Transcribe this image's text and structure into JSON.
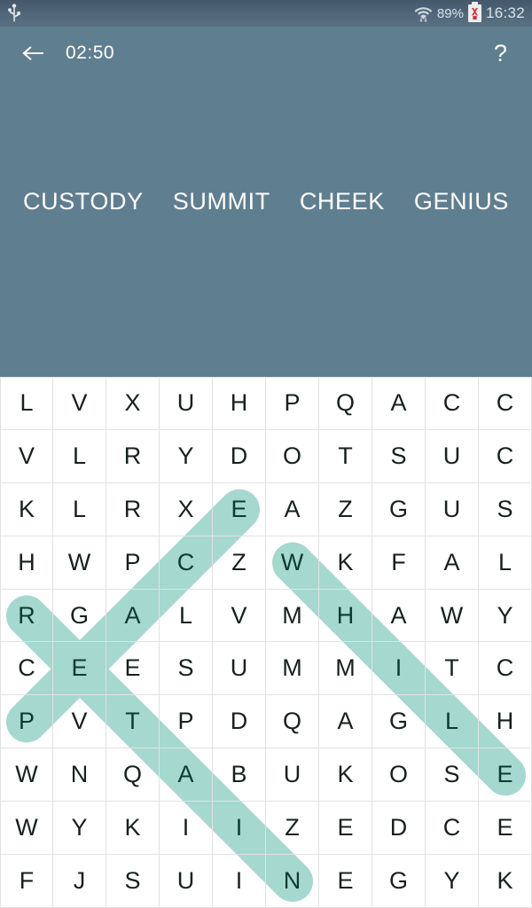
{
  "statusbar": {
    "usb_icon": "usb-icon",
    "wifi_icon": "wifi-icon",
    "battery_percent": "89%",
    "battery_icon": "battery-error-icon",
    "clock": "16:32"
  },
  "appbar": {
    "back_icon": "back-arrow-icon",
    "timer": "02:50",
    "help_label": "?"
  },
  "words": [
    {
      "text": "CUSTODY",
      "found": false
    },
    {
      "text": "SUMMIT",
      "found": false
    },
    {
      "text": "CHEEK",
      "found": false
    },
    {
      "text": "GENIUS",
      "found": false
    }
  ],
  "grid": {
    "rows": 10,
    "cols": 10,
    "letters": [
      [
        "L",
        "V",
        "X",
        "U",
        "H",
        "P",
        "Q",
        "A",
        "C",
        "C"
      ],
      [
        "V",
        "L",
        "R",
        "Y",
        "D",
        "O",
        "T",
        "S",
        "U",
        "C"
      ],
      [
        "K",
        "L",
        "R",
        "X",
        "E",
        "A",
        "Z",
        "G",
        "U",
        "S"
      ],
      [
        "H",
        "W",
        "P",
        "C",
        "Z",
        "W",
        "K",
        "F",
        "A",
        "L"
      ],
      [
        "R",
        "G",
        "A",
        "L",
        "V",
        "M",
        "H",
        "A",
        "W",
        "Y"
      ],
      [
        "C",
        "E",
        "E",
        "S",
        "U",
        "M",
        "M",
        "I",
        "T",
        "C"
      ],
      [
        "P",
        "V",
        "T",
        "P",
        "D",
        "Q",
        "A",
        "G",
        "L",
        "H"
      ],
      [
        "W",
        "N",
        "Q",
        "A",
        "B",
        "U",
        "K",
        "O",
        "S",
        "E"
      ],
      [
        "W",
        "Y",
        "K",
        "I",
        "I",
        "Z",
        "E",
        "D",
        "C",
        "E"
      ],
      [
        "F",
        "J",
        "S",
        "U",
        "I",
        "N",
        "E",
        "G",
        "Y",
        "K"
      ]
    ]
  },
  "selections": [
    {
      "name": "selection-ecaep",
      "letters": "E C A E P",
      "start": {
        "row": 2,
        "col": 4
      },
      "end": {
        "row": 6,
        "col": 0
      }
    },
    {
      "name": "selection-retain",
      "letters": "R E T A I N",
      "start": {
        "row": 4,
        "col": 0
      },
      "end": {
        "row": 9,
        "col": 5
      }
    },
    {
      "name": "selection-while",
      "letters": "W H I L E",
      "start": {
        "row": 3,
        "col": 5
      },
      "end": {
        "row": 7,
        "col": 9
      }
    }
  ],
  "colors": {
    "header_bg": "#5f7e90",
    "statusbar_bg": "#51687a",
    "grid_bg": "#ffffff",
    "grid_line": "#e2e2e2",
    "highlight": "#a5d8cf",
    "letter": "#18201f",
    "letter_marked": "#0d3a33"
  }
}
